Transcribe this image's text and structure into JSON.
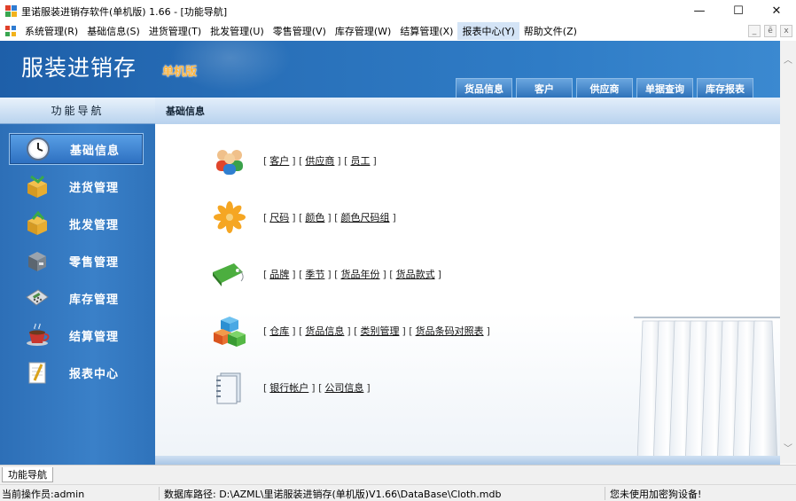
{
  "window": {
    "title": "里诺服装进销存软件(单机版) 1.66 - [功能导航]",
    "controls": [
      "minimize-icon",
      "maximize-icon",
      "close-icon"
    ]
  },
  "menu": {
    "items": [
      {
        "label": "系统管理(R)"
      },
      {
        "label": "基础信息(S)"
      },
      {
        "label": "进货管理(T)"
      },
      {
        "label": "批发管理(U)"
      },
      {
        "label": "零售管理(V)"
      },
      {
        "label": "库存管理(W)"
      },
      {
        "label": "结算管理(X)"
      },
      {
        "label": "报表中心(Y)"
      },
      {
        "label": "帮助文件(Z)"
      }
    ],
    "mdi_buttons": [
      "_",
      "ē",
      "x"
    ]
  },
  "banner": {
    "brand": "服装进销存",
    "edition": "单机版",
    "tabs": [
      "货品信息",
      "客户",
      "供应商",
      "单据查询",
      "库存报表"
    ]
  },
  "nav": {
    "header": "功能导航",
    "items": [
      {
        "label": "基础信息",
        "icon": "clock-icon",
        "active": true
      },
      {
        "label": "进货管理",
        "icon": "box-in-icon",
        "active": false
      },
      {
        "label": "批发管理",
        "icon": "box-out-icon",
        "active": false
      },
      {
        "label": "零售管理",
        "icon": "cash-drawer-icon",
        "active": false
      },
      {
        "label": "库存管理",
        "icon": "calculator-icon",
        "active": false
      },
      {
        "label": "结算管理",
        "icon": "cup-icon",
        "active": false
      },
      {
        "label": "报表中心",
        "icon": "notepad-icon",
        "active": false
      }
    ]
  },
  "content": {
    "header": "基础信息",
    "rows": [
      {
        "icon": "users-icon",
        "links": [
          "客户",
          "供应商",
          "员工"
        ]
      },
      {
        "icon": "flower-icon",
        "links": [
          "尺码",
          "颜色",
          "颜色尺码组"
        ]
      },
      {
        "icon": "tag-icon",
        "links": [
          "品牌",
          "季节",
          "货品年份",
          "货品款式"
        ]
      },
      {
        "icon": "cubes-icon",
        "links": [
          "仓库",
          "货品信息",
          "类别管理",
          "货品条码对照表"
        ]
      },
      {
        "icon": "book-icon",
        "links": [
          "银行帐户",
          "公司信息"
        ]
      }
    ]
  },
  "bottom_tab": "功能导航",
  "status": {
    "operator": "当前操作员:admin",
    "db_path": "数据库路径: D:\\AZML\\里诺服装进销存(单机版)V1.66\\DataBase\\Cloth.mdb",
    "device": "您未使用加密狗设备!"
  }
}
